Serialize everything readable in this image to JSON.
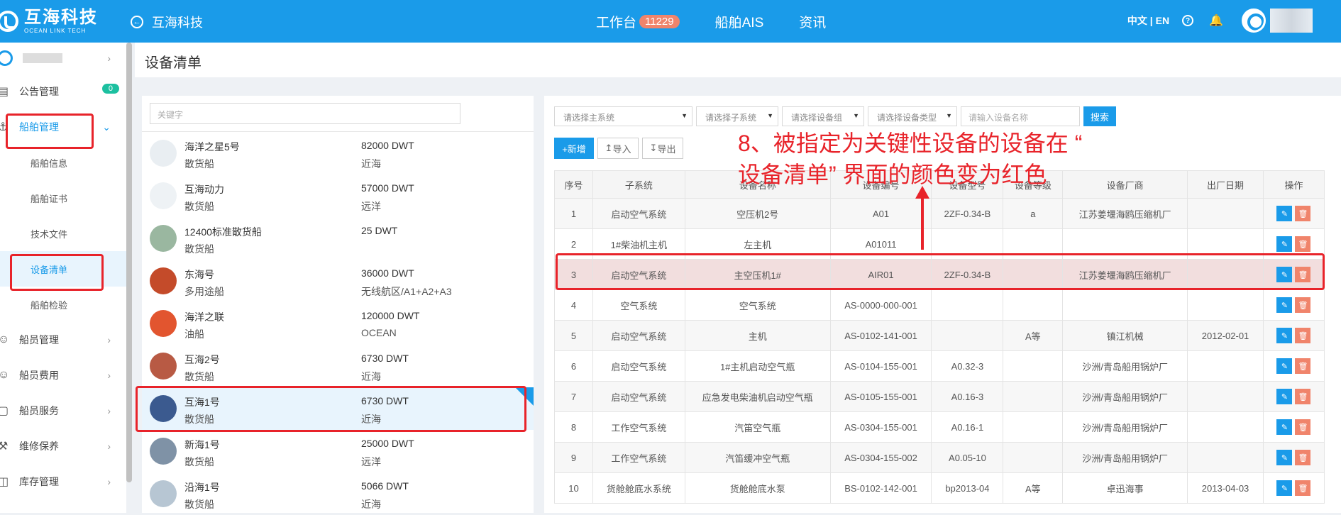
{
  "topbar": {
    "logo_cn": "互海科技",
    "logo_en": "OCEAN LINK TECH",
    "crumb": "互海科技",
    "nav": [
      {
        "label": "工作台",
        "badge": "11229"
      },
      {
        "label": "船舶AIS"
      },
      {
        "label": "资讯"
      }
    ],
    "lang": "中文 | EN"
  },
  "sidebar": {
    "items": [
      {
        "label": "公告管理",
        "badge": "0"
      },
      {
        "label": "船舶管理"
      },
      {
        "label": "船员管理"
      },
      {
        "label": "船员费用"
      },
      {
        "label": "船员服务"
      },
      {
        "label": "维修保养"
      },
      {
        "label": "库存管理"
      }
    ],
    "subs": [
      "船舶信息",
      "船舶证书",
      "技术文件",
      "设备清单",
      "船舶检验"
    ]
  },
  "page": {
    "title": "设备清单"
  },
  "search": {
    "keyword_placeholder": "关键字"
  },
  "ships": [
    {
      "name": "海洋之星5号",
      "type": "散货船",
      "dwt": "82000 DWT",
      "area": "近海"
    },
    {
      "name": "互海动力",
      "type": "散货船",
      "dwt": "57000 DWT",
      "area": "远洋"
    },
    {
      "name": "12400标准散货船",
      "type": "散货船",
      "dwt": "25 DWT",
      "area": ""
    },
    {
      "name": "东海号",
      "type": "多用途船",
      "dwt": "36000 DWT",
      "area": "无线航区/A1+A2+A3"
    },
    {
      "name": "海洋之联",
      "type": "油船",
      "dwt": "120000 DWT",
      "area": "OCEAN"
    },
    {
      "name": "互海2号",
      "type": "散货船",
      "dwt": "6730 DWT",
      "area": "近海"
    },
    {
      "name": "互海1号",
      "type": "散货船",
      "dwt": "6730 DWT",
      "area": "近海"
    },
    {
      "name": "新海1号",
      "type": "散货船",
      "dwt": "25000 DWT",
      "area": "远洋"
    },
    {
      "name": "沿海1号",
      "type": "散货船",
      "dwt": "5066 DWT",
      "area": "近海"
    }
  ],
  "filters": {
    "main_system": "请选择主系统",
    "sub_system": "请选择子系统",
    "device_group": "请选择设备组",
    "device_type": "请选择设备类型",
    "device_name": "请输入设备名称",
    "search": "搜索"
  },
  "actions": {
    "add": "+新增",
    "import": "导入",
    "export": "导出"
  },
  "table": {
    "headers": [
      "序号",
      "子系统",
      "设备名称",
      "设备编号",
      "设备型号",
      "设备等级",
      "设备厂商",
      "出厂日期",
      "操作"
    ],
    "rows": [
      {
        "c": [
          "1",
          "启动空气系统",
          "空压机2号",
          "A01",
          "2ZF-0.34-B",
          "a",
          "江苏姜堰海鸥压缩机厂",
          ""
        ]
      },
      {
        "c": [
          "2",
          "1#柴油机主机",
          "左主机",
          "A01011",
          "",
          "",
          "",
          ""
        ]
      },
      {
        "c": [
          "3",
          "启动空气系统",
          "主空压机1#",
          "AIR01",
          "2ZF-0.34-B",
          "",
          "江苏姜堰海鸥压缩机厂",
          ""
        ]
      },
      {
        "c": [
          "4",
          "空气系统",
          "空气系统",
          "AS-0000-000-001",
          "",
          "",
          "",
          ""
        ]
      },
      {
        "c": [
          "5",
          "启动空气系统",
          "主机",
          "AS-0102-141-001",
          "",
          "A等",
          "镇江机械",
          "2012-02-01"
        ]
      },
      {
        "c": [
          "6",
          "启动空气系统",
          "1#主机启动空气瓶",
          "AS-0104-155-001",
          "A0.32-3",
          "",
          "沙洲/青岛船用锅炉厂",
          ""
        ]
      },
      {
        "c": [
          "7",
          "启动空气系统",
          "应急发电柴油机启动空气瓶",
          "AS-0105-155-001",
          "A0.16-3",
          "",
          "沙洲/青岛船用锅炉厂",
          ""
        ]
      },
      {
        "c": [
          "8",
          "工作空气系统",
          "汽笛空气瓶",
          "AS-0304-155-001",
          "A0.16-1",
          "",
          "沙洲/青岛船用锅炉厂",
          ""
        ]
      },
      {
        "c": [
          "9",
          "工作空气系统",
          "汽笛缓冲空气瓶",
          "AS-0304-155-002",
          "A0.05-10",
          "",
          "沙洲/青岛船用锅炉厂",
          ""
        ]
      },
      {
        "c": [
          "10",
          "货舱舱底水系统",
          "货舱舱底水泵",
          "BS-0102-142-001",
          "bp2013-04",
          "A等",
          "卓迅海事",
          "2013-04-03"
        ]
      }
    ]
  },
  "annotation": {
    "line1": "8、被指定为关键性设备的设备在 “",
    "line2": "设备清单” 界面的颜色变为红色"
  },
  "colors": {
    "accent": "#1a9be9",
    "critical_row": "#f2dede",
    "annotation": "#e8232a"
  }
}
